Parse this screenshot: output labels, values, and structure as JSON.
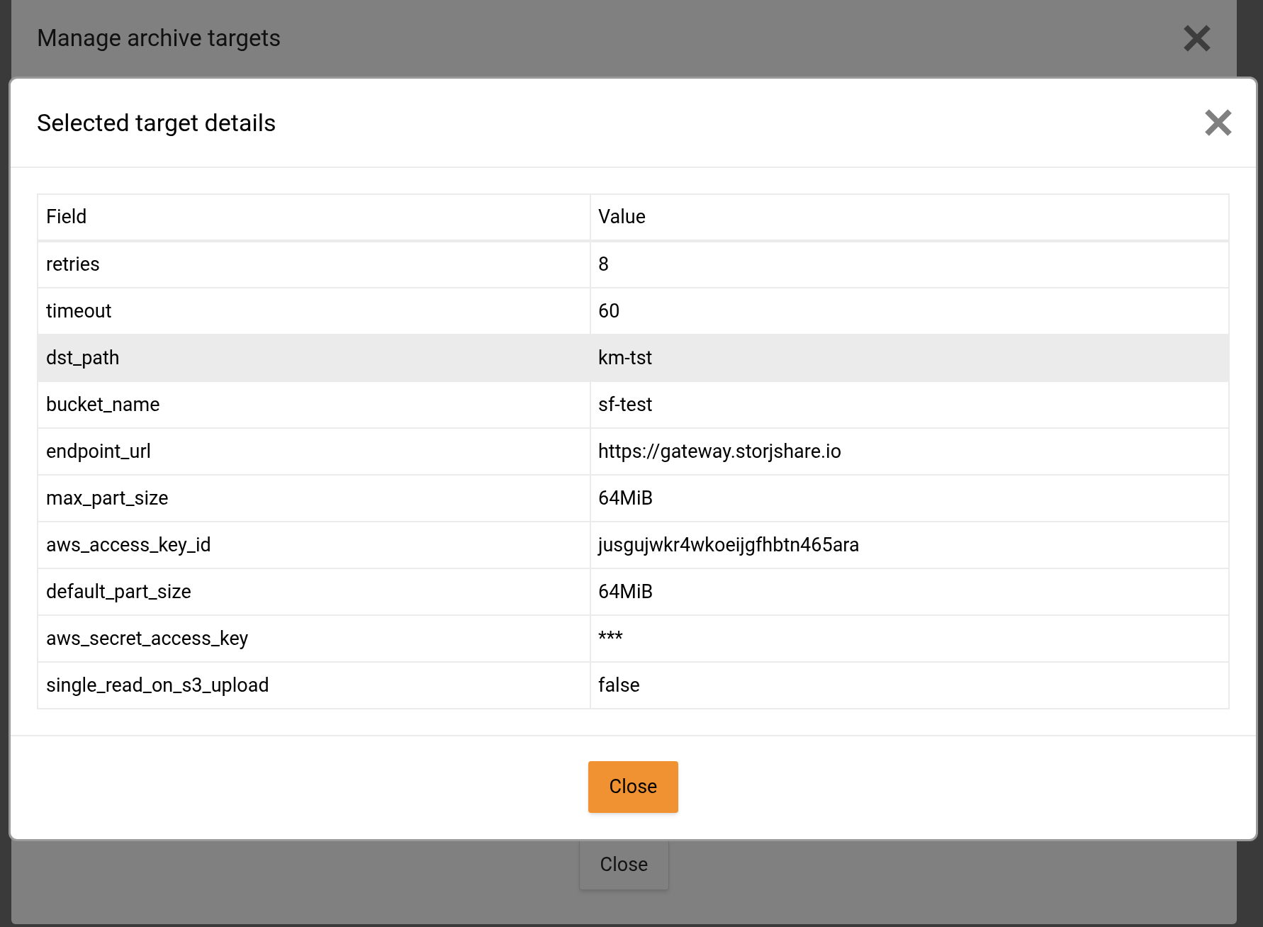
{
  "outer_dialog": {
    "title": "Manage archive targets",
    "close_label": "Close"
  },
  "dialog": {
    "title": "Selected target details",
    "close_label": "Close"
  },
  "table": {
    "columns": [
      "Field",
      "Value"
    ],
    "rows": [
      {
        "field": "retries",
        "value": "8",
        "selected": false
      },
      {
        "field": "timeout",
        "value": "60",
        "selected": false
      },
      {
        "field": "dst_path",
        "value": "km-tst",
        "selected": true
      },
      {
        "field": "bucket_name",
        "value": "sf-test",
        "selected": false
      },
      {
        "field": "endpoint_url",
        "value": "https://gateway.storjshare.io",
        "selected": false
      },
      {
        "field": "max_part_size",
        "value": "64MiB",
        "selected": false
      },
      {
        "field": "aws_access_key_id",
        "value": "jusgujwkr4wkoeijgfhbtn465ara",
        "selected": false
      },
      {
        "field": "default_part_size",
        "value": "64MiB",
        "selected": false
      },
      {
        "field": "aws_secret_access_key",
        "value": "***",
        "selected": false
      },
      {
        "field": "single_read_on_s3_upload",
        "value": "false",
        "selected": false
      }
    ]
  }
}
